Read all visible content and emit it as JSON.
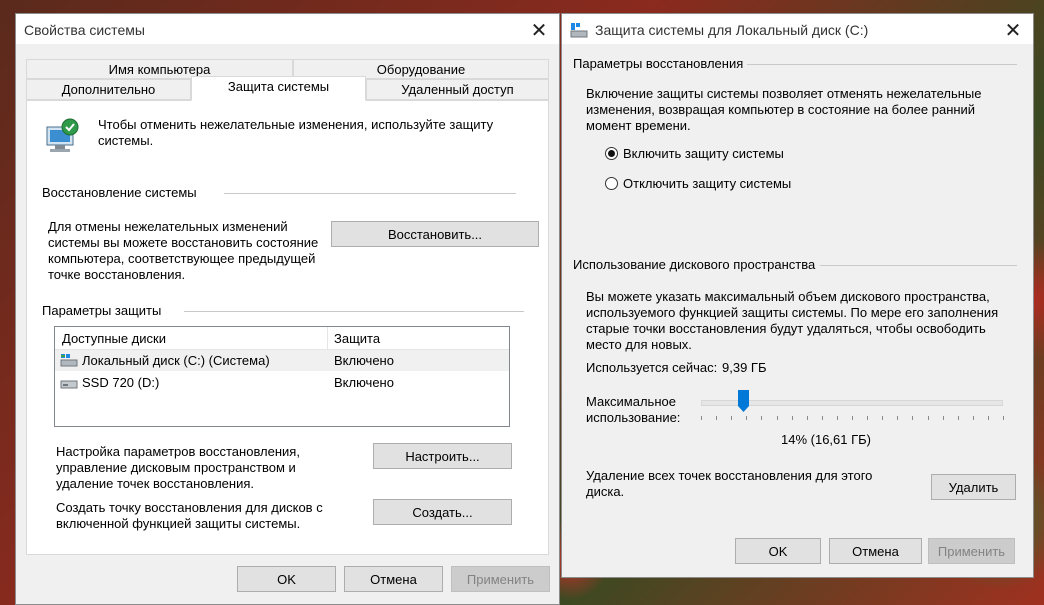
{
  "left_window": {
    "title": "Свойства системы",
    "tabs": {
      "row_top": [
        "Имя компьютера",
        "Оборудование"
      ],
      "row_bottom": [
        "Дополнительно",
        "Защита системы",
        "Удаленный доступ"
      ]
    },
    "intro_text": "Чтобы отменить нежелательные изменения, используйте защиту системы.",
    "restore_group": "Восстановление системы",
    "restore_text": "Для отмены нежелательных изменений системы вы можете восстановить состояние компьютера, соответствующее предыдущей точке восстановления.",
    "restore_button": "Восстановить...",
    "protection_group": "Параметры защиты",
    "disks_table": {
      "headers": [
        "Доступные диски",
        "Защита"
      ],
      "rows": [
        {
          "name": "Локальный диск (C:) (Система)",
          "status": "Включено"
        },
        {
          "name": "SSD 720 (D:)",
          "status": "Включено"
        }
      ]
    },
    "configure_text": "Настройка параметров восстановления, управление дисковым пространством и удаление точек восстановления.",
    "configure_button": "Настроить...",
    "create_text": "Создать точку восстановления для дисков с включенной функцией защиты системы.",
    "create_button": "Создать...",
    "ok_button": "OK",
    "cancel_button": "Отмена",
    "apply_button": "Применить"
  },
  "right_window": {
    "title": "Защита системы для Локальный диск (C:)",
    "restore_settings_group": "Параметры восстановления",
    "restore_settings_text": "Включение защиты системы позволяет отменять нежелательные изменения, возвращая компьютер в состояние на более ранний момент времени.",
    "radio_on": "Включить защиту системы",
    "radio_off": "Отключить защиту системы",
    "disk_usage_group": "Использование дискового пространства",
    "disk_usage_text": "Вы можете указать максимальный объем дискового пространства, используемого функцией защиты системы. По мере его заполнения старые точки восстановления будут удаляться, чтобы освободить место для новых.",
    "current_usage_label": "Используется сейчас:",
    "current_usage_value": "9,39 ГБ",
    "max_usage_label": "Максимальное использование:",
    "slider_percent": 14,
    "slider_value_text": "14% (16,61 ГБ)",
    "delete_text": "Удаление всех точек восстановления для этого диска.",
    "delete_button": "Удалить",
    "ok_button": "OK",
    "cancel_button": "Отмена",
    "apply_button": "Применить"
  },
  "colors": {
    "selected_row": "#f0f0f0",
    "slider_thumb": "#0078d7"
  }
}
